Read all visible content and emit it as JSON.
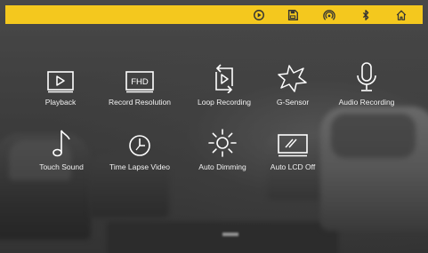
{
  "status_bar": {
    "accent_color": "#f4c81e",
    "icons": [
      "playback-mode-icon",
      "storage-card-icon",
      "wifi-hotspot-icon",
      "bluetooth-icon",
      "home-icon"
    ]
  },
  "menu": {
    "items": [
      {
        "label": "Playback",
        "icon": "play-square-icon"
      },
      {
        "label": "Record Resolution",
        "icon": "fhd-icon",
        "icon_text": "FHD"
      },
      {
        "label": "Loop Recording",
        "icon": "loop-recording-icon"
      },
      {
        "label": "G-Sensor",
        "icon": "star-burst-icon"
      },
      {
        "label": "Audio Recording",
        "icon": "microphone-icon"
      },
      {
        "label": "Touch Sound",
        "icon": "music-note-icon"
      },
      {
        "label": "Time Lapse Video",
        "icon": "clock-icon"
      },
      {
        "label": "Auto Dimming",
        "icon": "sun-icon"
      },
      {
        "label": "Auto LCD Off",
        "icon": "screen-off-icon"
      }
    ]
  }
}
